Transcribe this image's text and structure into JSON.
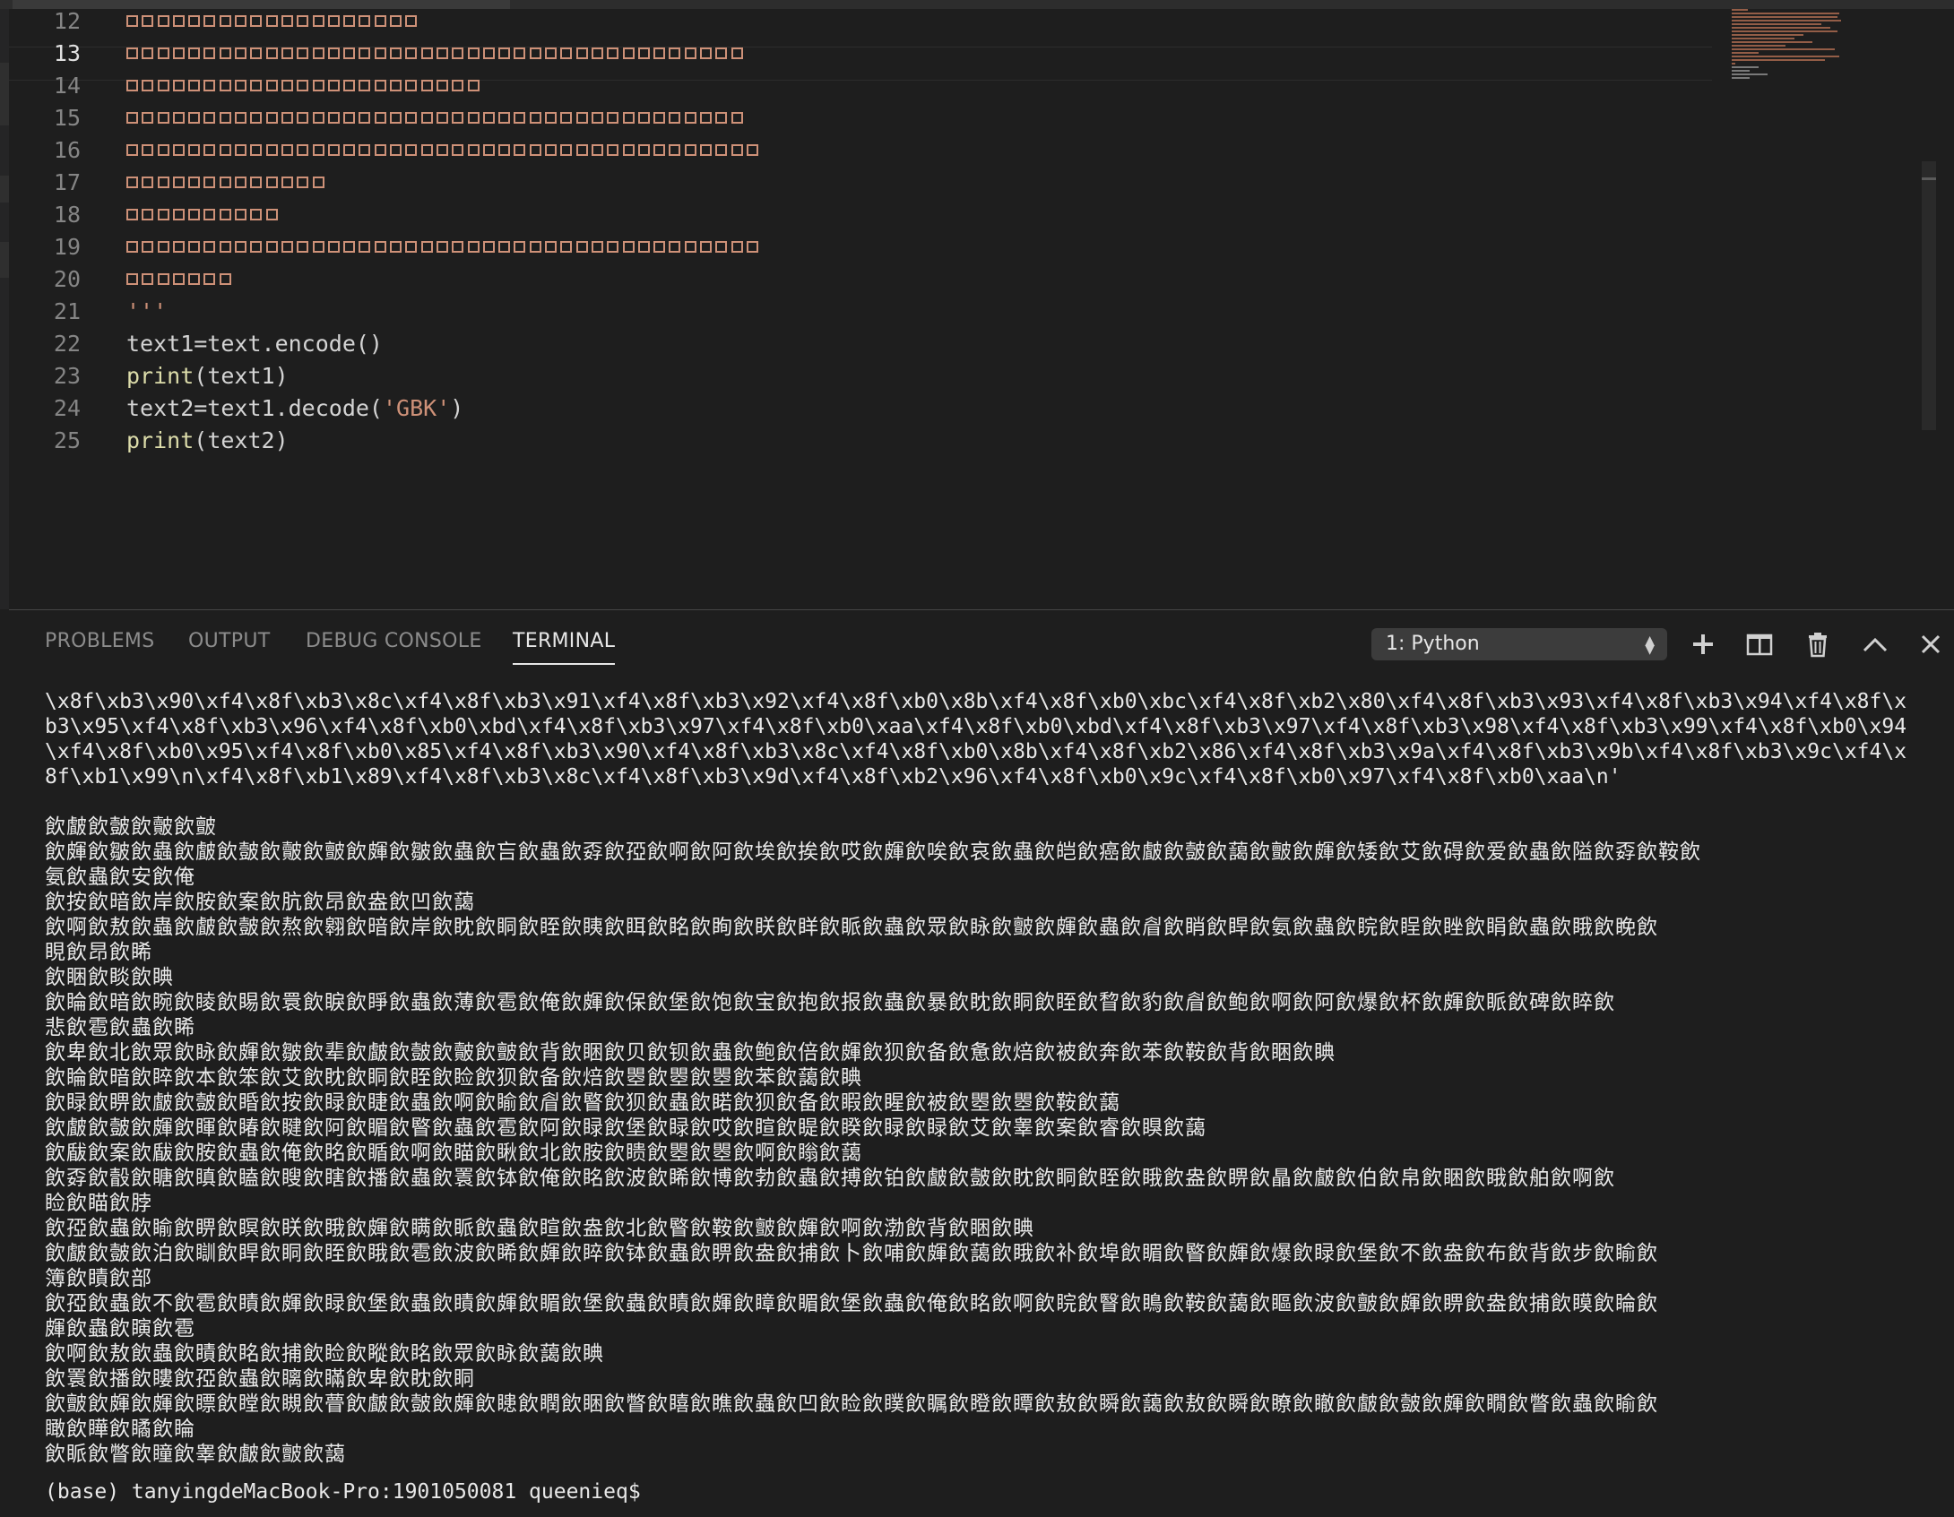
{
  "editor": {
    "lines": [
      {
        "num": "12",
        "kind": "boxes",
        "count": 19
      },
      {
        "num": "13",
        "kind": "boxes",
        "count": 40,
        "active": true
      },
      {
        "num": "14",
        "kind": "boxes",
        "count": 23
      },
      {
        "num": "15",
        "kind": "boxes",
        "count": 40
      },
      {
        "num": "16",
        "kind": "boxes",
        "count": 41
      },
      {
        "num": "17",
        "kind": "boxes",
        "count": 13
      },
      {
        "num": "18",
        "kind": "boxes",
        "count": 10
      },
      {
        "num": "19",
        "kind": "boxes",
        "count": 41
      },
      {
        "num": "20",
        "kind": "boxes",
        "count": 7
      },
      {
        "num": "21",
        "kind": "code",
        "text": "'''"
      },
      {
        "num": "22",
        "kind": "code",
        "text": "text1=text.encode()"
      },
      {
        "num": "23",
        "kind": "code",
        "text": "print(text1)"
      },
      {
        "num": "24",
        "kind": "code",
        "text": "text2=text1.decode('GBK')"
      },
      {
        "num": "25",
        "kind": "code",
        "text": "print(text2)"
      }
    ]
  },
  "panel": {
    "tabs": [
      {
        "label": "PROBLEMS",
        "active": false
      },
      {
        "label": "OUTPUT",
        "active": false
      },
      {
        "label": "DEBUG CONSOLE",
        "active": false
      },
      {
        "label": "TERMINAL",
        "active": true
      }
    ],
    "terminal_select": "1: Python",
    "icons": [
      "plus-icon",
      "split-icon",
      "trash-icon",
      "chevron-up-icon",
      "close-icon"
    ]
  },
  "terminal": {
    "bytes_lines": [
      "\\x8f\\xb3\\x90\\xf4\\x8f\\xb3\\x8c\\xf4\\x8f\\xb3\\x91\\xf4\\x8f\\xb3\\x92\\xf4\\x8f\\xb0\\x8b\\xf4\\x8f\\xb0\\xbc\\xf4\\x8f\\xb2\\x80\\xf4\\x8f\\xb3\\x93\\xf4\\x8f\\xb3\\x94\\xf4\\x8f\\x",
      "b3\\x95\\xf4\\x8f\\xb3\\x96\\xf4\\x8f\\xb0\\xbd\\xf4\\x8f\\xb3\\x97\\xf4\\x8f\\xb0\\xaa\\xf4\\x8f\\xb0\\xbd\\xf4\\x8f\\xb3\\x97\\xf4\\x8f\\xb3\\x98\\xf4\\x8f\\xb3\\x99\\xf4\\x8f\\xb0\\x94",
      "\\xf4\\x8f\\xb0\\x95\\xf4\\x8f\\xb0\\x85\\xf4\\x8f\\xb3\\x90\\xf4\\x8f\\xb3\\x8c\\xf4\\x8f\\xb0\\x8b\\xf4\\x8f\\xb2\\x86\\xf4\\x8f\\xb3\\x9a\\xf4\\x8f\\xb3\\x9b\\xf4\\x8f\\xb3\\x9c\\xf4\\x",
      "8f\\xb1\\x99\\n\\xf4\\x8f\\xb1\\x89\\xf4\\x8f\\xb3\\x8c\\xf4\\x8f\\xb3\\x9d\\xf4\\x8f\\xb2\\x96\\xf4\\x8f\\xb0\\x9c\\xf4\\x8f\\xb0\\x97\\xf4\\x8f\\xb0\\xaa\\n'"
    ],
    "decoded_lines": [
      "飲皻飲皼飲皾飲皽",
      "飲皹飲皺飲蟲飲皻飲皼飲皾飲皽飲皹飲皺飲蟲飲吂飲蟲飲孬飲孲飲啊飲阿飲埃飲挨飲哎飲皹飲唉飲哀飲蟲飲皑飲癌飲皻飲皼飲藹飲皽飲皹飲矮飲艾飲碍飲爱飲蟲飲隘飲孬飲鞍飲",
      "氨飲蟲飲安飲俺",
      "飲按飲暗飲岸飲胺飲案飲肮飲昂飲盎飲凹飲藹",
      "飲啊飲敖飲蟲飲皻飲皼飲熬飲翱飲暗飲岸飲眈飲眮飲眰飲眱飲眲飲眳飲眴飲眹飲眻飲眽飲蟲飲眾飲眿飲皽飲皹飲蟲飲睂飲睄飲睅飲氨飲蟲飲睆飲睈飲睉飲睊飲蟲飲睋飲睌飲",
      "睍飲昂飲睎",
      "飲睏飲睒飲睓",
      "飲睔飲暗飲睕飲睖飲睗飲睘飲睙飲睜飲蟲飲薄飲雹飲俺飲皹飲保飲堡飲饱飲宝飲抱飲报飲蟲飲暴飲眈飲眮飲眰飲睝飲豹飲睂飲鲍飲啊飲阿飲爆飲杯飲皹飲眽飲碑飲睟飲",
      "悲飲雹飲蟲飲睎",
      "飲卑飲北飲眾飲眿飲皹飲皺飲辈飲皻飲皼飲皾飲皽飲背飲睏飲贝飲钡飲蟲飲鲍飲倍飲皹飲狈飲备飲惫飲焙飲被飲奔飲苯飲鞍飲背飲睏飲睓",
      "飲睔飲暗飲睟飲本飲笨飲艾飲眈飲眮飲眰飲睑飲狈飲备飲焙飲瞾飲瞾飲瞾飲苯飲藹飲睓",
      "飲睩飲睤飲皻飲皼飲睧飲按飲睩飲睫飲蟲飲啊飲睮飲睂飲睯飲狈飲蟲飲睰飲狈飲备飲睱飲睲飲被飲瞾飲瞾飲鞍飲藹",
      "飲皻飲皼飲皹飲睴飲睶飲睷飲阿飲睸飲睯飲蟲飲雹飲阿飲睩飲堡飲睩飲哎飲睻飲睼飲睽飲睩飲睩飲艾飲睾飲案飲睿飲瞁飲藹",
      "飲瞂飲案飲瞂飲胺飲蟲飲俺飲眳飲瞃飲啊飲瞄飲瞅飲北飲胺飲瞆飲瞾飲瞾飲啊飲瞈飲藹",
      "飲孬飲瞉飲瞊飲瞋飲瞌飲瞍飲瞎飲播飲蟲飲瞏飲钵飲俺飲眳飲波飲睎飲博飲勃飲蟲飲搏飲铂飲皻飲皼飲眈飲眮飲眰飲睋飲盎飲睤飲瞐飲皻飲伯飲帛飲睏飲睋飲舶飲啊飲",
      "睑飲瞄飲脖",
      "飲孲飲蟲飲睮飲睤飲瞑飲眹飲睋飲皹飲瞒飲眽飲蟲飲睻飲盎飲北飲睯飲鞍飲皽飲皹飲啊飲渤飲背飲睏飲睓",
      "飲皻飲皼飲泊飲瞓飲睅飲眮飲眰飲睋飲雹飲波飲睎飲皹飲睟飲钵飲蟲飲睤飲盎飲捕飲卜飲哺飲皹飲藹飲睋飲补飲埠飲睸飲睯飲皹飲爆飲睩飲堡飲不飲盎飲布飲背飲步飲睮飲",
      "簿飲瞔飲部",
      "飲孲飲蟲飲不飲雹飲瞔飲皹飲睩飲堡飲蟲飲瞔飲皹飲睸飲堡飲蟲飲瞔飲皹飲瞕飲睸飲堡飲蟲飲俺飲眳飲啊飲睆飲瞖飲瞗飲鞍飲藹飲瞘飲波飲皽飲皹飲睤飲盎飲捕飲瞙飲睔飲",
      "皹飲蟲飲瞚飲雹",
      "飲啊飲敖飲蟲飲瞔飲眳飲捕飲睑飲瞛飲眳飲眾飲眿飲藹飲睓",
      "飲瞏飲播飲瞜飲孲飲蟲飲瞝飲瞞飲卑飲眈飲眮",
      "飲皽飲皹飲皹飲瞟飲瞠飲瞡飲瞢飲皻飲皼飲皹飲瞣飲瞤飲睏飲瞥飲瞦飲瞧飲蟲飲凹飲睑飲瞨飲瞩飲瞪飲瞫飲敖飲瞬飲藹飲敖飲瞬飲瞭飲瞮飲皻飲皼飲皹飲瞯飲瞥飲蟲飲睮飲",
      "瞰飲瞱飲瞲飲睔",
      "飲眽飲瞥飲瞳飲睾飲皻飲皽飲藹"
    ],
    "prompt": "(base) tanyingdeMacBook-Pro:1901050081 queenieq$"
  }
}
